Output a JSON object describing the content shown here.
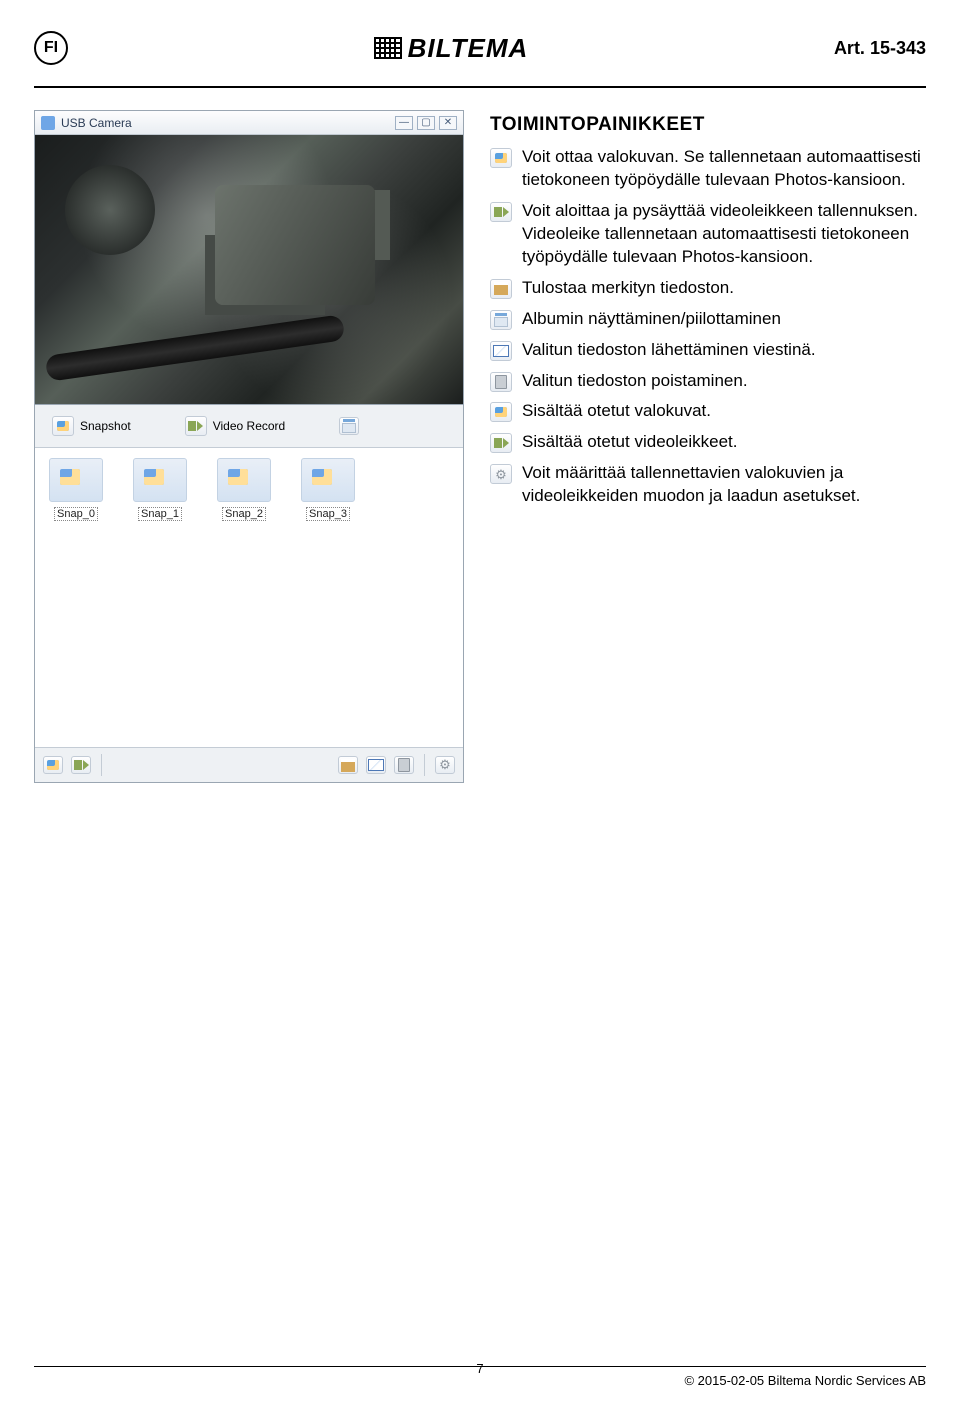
{
  "header": {
    "lang": "FI",
    "logo": "BILTEMA",
    "art": "Art. 15-343"
  },
  "app": {
    "title": "USB Camera",
    "snapshot_label": "Snapshot",
    "record_label": "Video Record",
    "thumbs": [
      "Snap_0",
      "Snap_1",
      "Snap_2",
      "Snap_3"
    ]
  },
  "desc": {
    "title": "TOIMINTOPAINIKKEET",
    "items": [
      "Voit ottaa valokuvan. Se tallennetaan automaattisesti tietokoneen työpöydälle tulevaan Photos-kansioon.",
      "Voit aloittaa ja pysäyttää videoleikkeen tallennuksen. Videoleike tallennetaan automaattisesti tietokoneen työpöydälle tulevaan Photos-kansioon.",
      "Tulostaa merkityn tiedoston.",
      "Albumin näyttäminen/piilottaminen",
      "Valitun tiedoston lähettäminen viestinä.",
      "Valitun tiedoston poistaminen.",
      "Sisältää otetut valokuvat.",
      "Sisältää otetut videoleikkeet.",
      "Voit määrittää tallennettavien valokuvien ja videoleikkeiden muodon ja laadun asetukset."
    ]
  },
  "footer": {
    "page": "7",
    "copyright": "© 2015-02-05 Biltema Nordic Services AB"
  }
}
